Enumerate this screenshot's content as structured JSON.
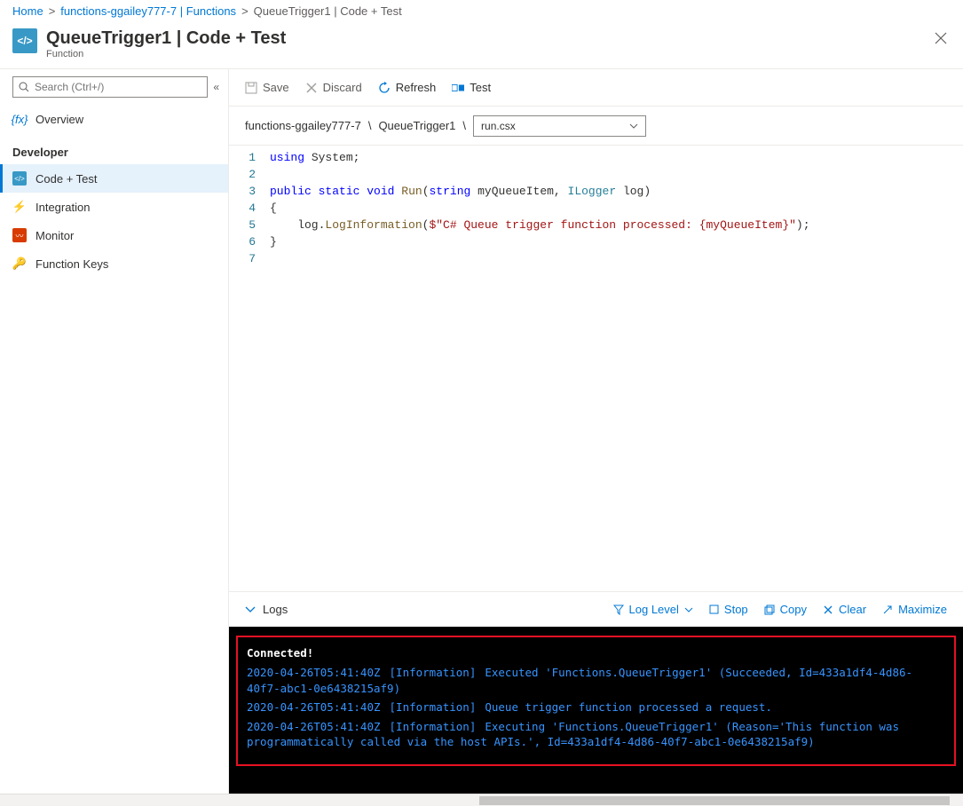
{
  "breadcrumb": {
    "home": "Home",
    "parent": "functions-ggailey777-7 | Functions",
    "current": "QueueTrigger1 | Code + Test"
  },
  "header": {
    "title": "QueueTrigger1 | Code + Test",
    "subtitle": "Function"
  },
  "search": {
    "placeholder": "Search (Ctrl+/)"
  },
  "sidebar": {
    "overview": "Overview",
    "section": "Developer",
    "items": {
      "code": "Code + Test",
      "integration": "Integration",
      "monitor": "Monitor",
      "keys": "Function Keys"
    }
  },
  "toolbar": {
    "save": "Save",
    "discard": "Discard",
    "refresh": "Refresh",
    "test": "Test"
  },
  "path": {
    "seg1": "functions-ggailey777-7",
    "seg2": "QueueTrigger1",
    "file": "run.csx"
  },
  "code": {
    "line_numbers": [
      "1",
      "2",
      "3",
      "4",
      "5",
      "6",
      "7"
    ],
    "l1_kw": "using",
    "l1_rest": " System;",
    "l3_kw1": "public",
    "l3_kw2": "static",
    "l3_kw3": "void",
    "l3_fn": "Run",
    "l3_sig_open": "(",
    "l3_t1": "string",
    "l3_p1": " myQueueItem, ",
    "l3_t2": "ILogger",
    "l3_p2": " log)",
    "l4": "{",
    "l5_indent": "    ",
    "l5_obj": "log.",
    "l5_fn": "LogInformation",
    "l5_open": "(",
    "l5_str": "$\"C# Queue trigger function processed: {myQueueItem}\"",
    "l5_close": ");",
    "l6": "}"
  },
  "logs": {
    "label": "Logs",
    "loglevel": "Log Level",
    "stop": "Stop",
    "copy": "Copy",
    "clear": "Clear",
    "maximize": "Maximize",
    "connected": "Connected!",
    "entries": [
      {
        "ts": "2020-04-26T05:41:40Z",
        "lvl": "[Information]",
        "msg_pre": "Executed ",
        "fn": "'Functions.QueueTrigger1'",
        "msg_post": " (Succeeded, Id=433a1df4-4d86-40f7-abc1-0e6438215af9)"
      },
      {
        "ts": "2020-04-26T05:41:40Z",
        "lvl": "[Information]",
        "msg_pre": "Queue trigger function processed a request.",
        "fn": "",
        "msg_post": ""
      },
      {
        "ts": "2020-04-26T05:41:40Z",
        "lvl": "[Information]",
        "msg_pre": "Executing ",
        "fn": "'Functions.QueueTrigger1'",
        "msg_post": " (Reason='This function was programmatically called via the host APIs.', Id=433a1df4-4d86-40f7-abc1-0e6438215af9)"
      }
    ]
  }
}
